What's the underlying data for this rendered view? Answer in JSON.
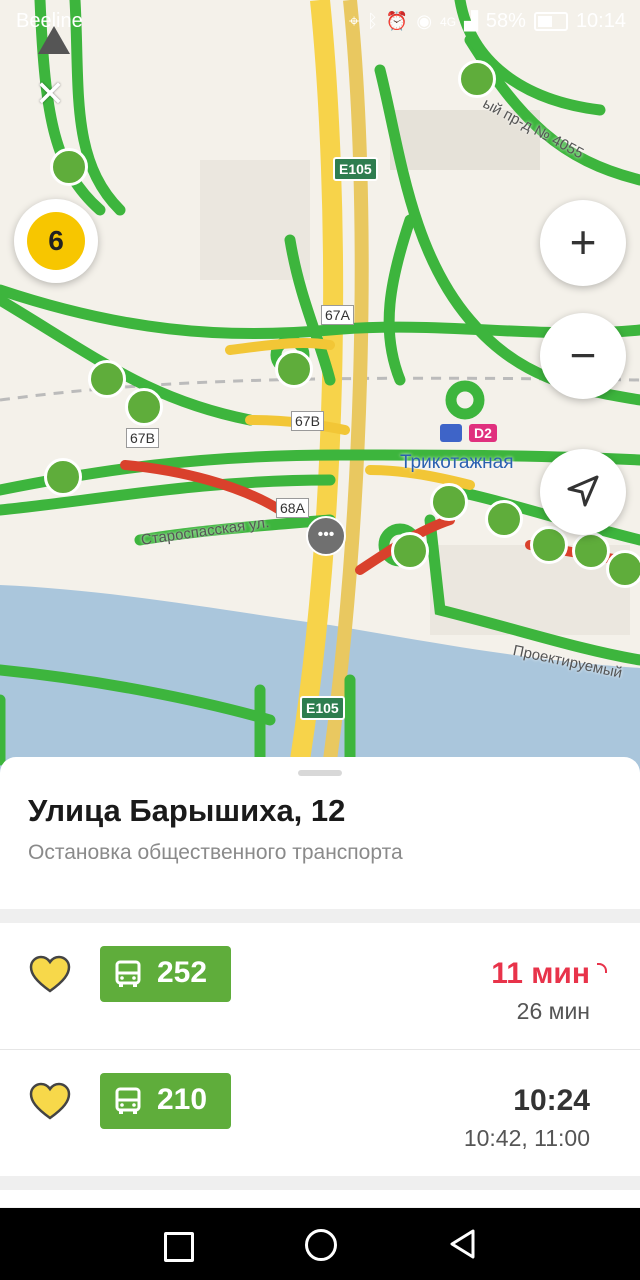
{
  "status_bar": {
    "carrier": "Beeline",
    "battery": "58%",
    "time": "10:14",
    "network": "4G"
  },
  "map": {
    "traffic_level": "6",
    "labels": {
      "e105_top": "E105",
      "e105_bottom": "E105",
      "r67a": "67A",
      "r67b_left": "67B",
      "r67b_mid": "67B",
      "r68a": "68A",
      "station": "Трикотажная",
      "d2": "D2",
      "street_staro": "Староспасская ул.",
      "street_proezd": "ый пр-д № 4055",
      "street_proekt": "Проектируемый"
    }
  },
  "stop": {
    "title": "Улица Барышиха, 12",
    "subtitle": "Остановка общественного транспорта"
  },
  "routes": [
    {
      "number": "252",
      "next": "11 мин",
      "next_color": "#e8334a",
      "following": "26 мин"
    },
    {
      "number": "210",
      "next": "10:24",
      "next_color": "#333333",
      "following": "10:42, 11:00"
    }
  ],
  "colors": {
    "route_badge": "#5fad3b",
    "favorite": "#f7d84a",
    "traffic": "#f7c600"
  }
}
